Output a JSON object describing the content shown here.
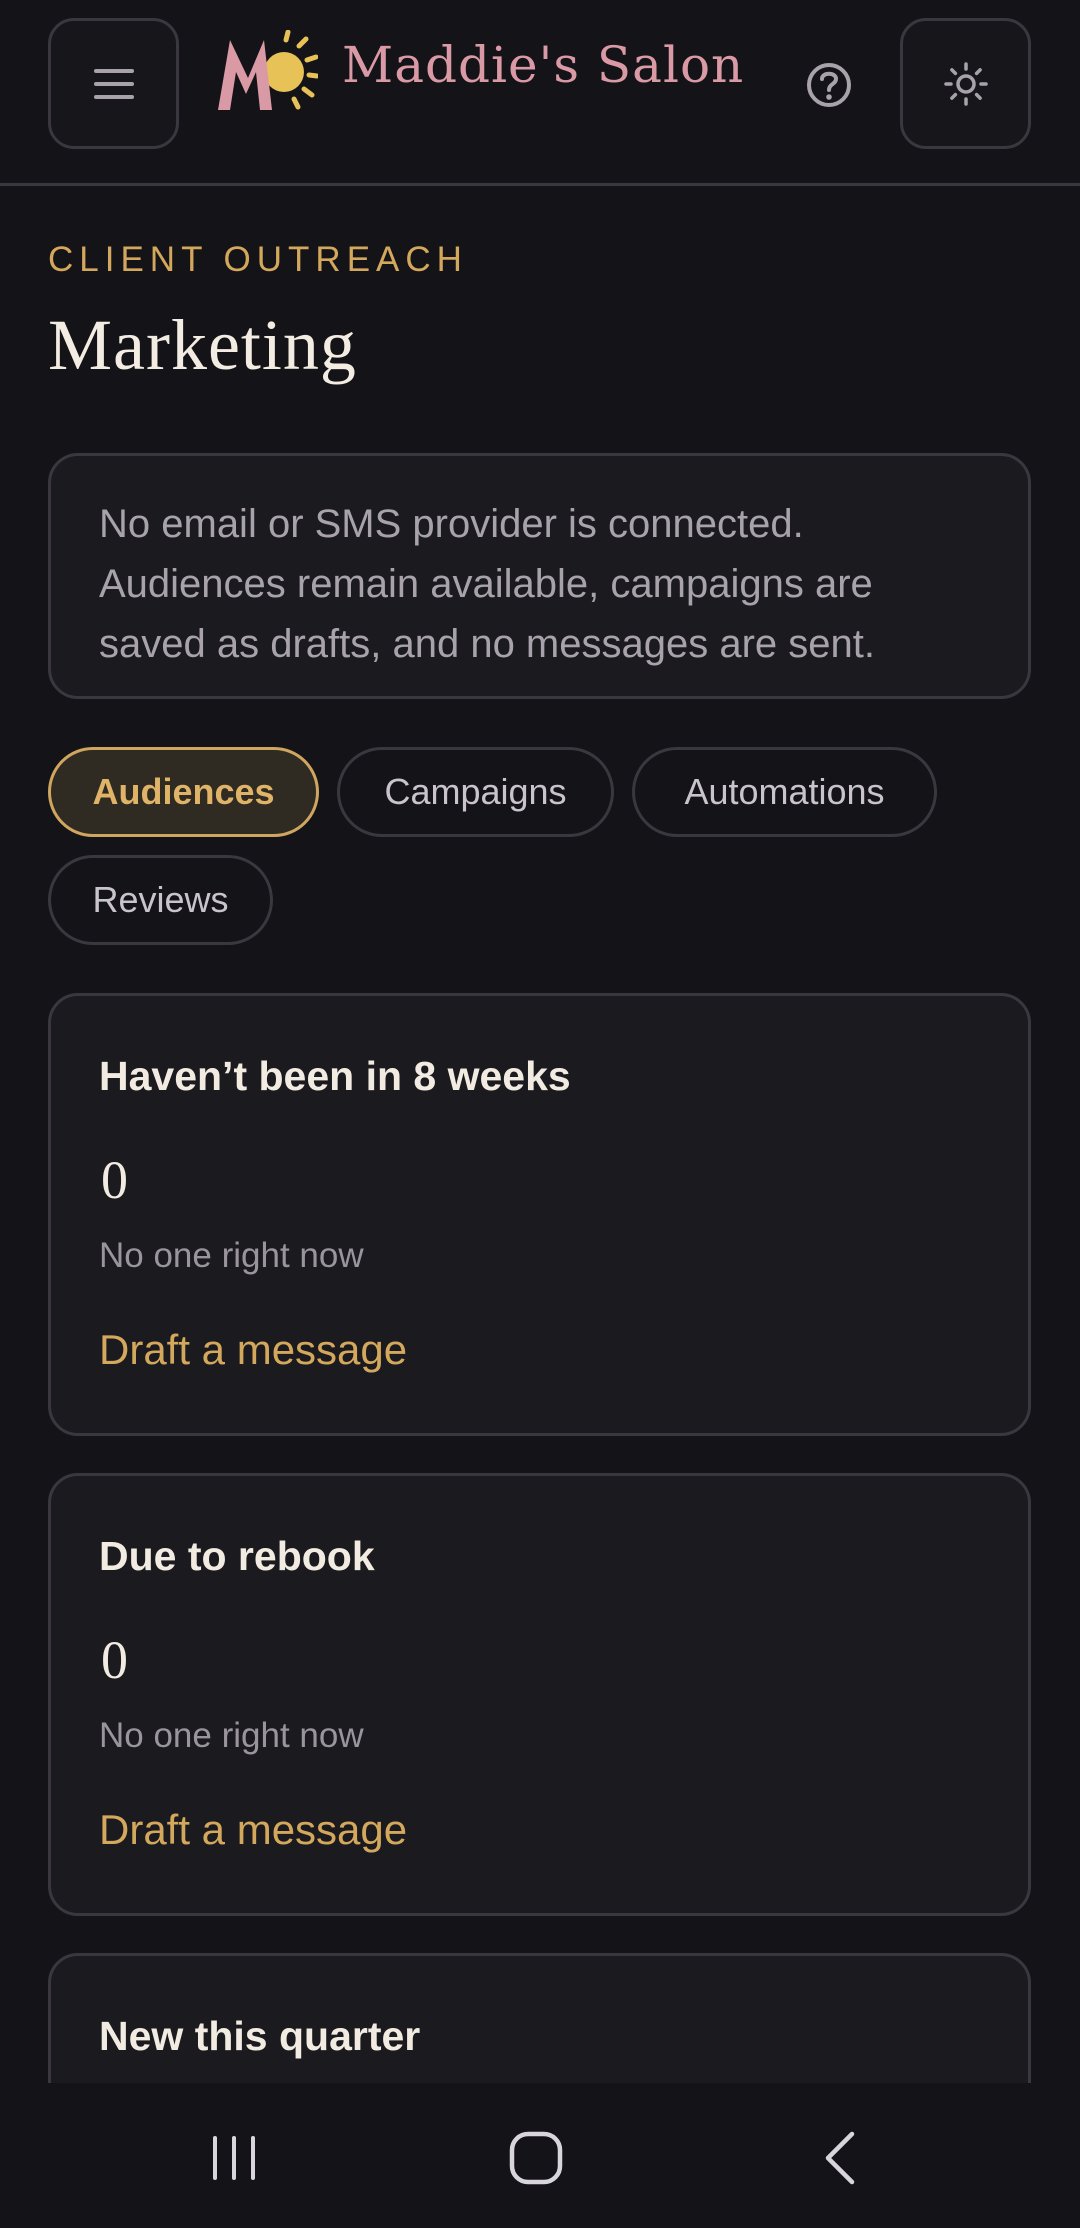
{
  "header": {
    "brand_name": "Maddie's Salon",
    "logo_letter": "M",
    "icons": {
      "menu": "hamburger-menu-icon",
      "help": "help-circle-icon",
      "theme": "sun-icon"
    }
  },
  "page": {
    "eyebrow": "CLIENT OUTREACH",
    "title": "Marketing"
  },
  "notice": {
    "line1": "No email or SMS provider is connected.",
    "line2": "Audiences remain available, campaigns are",
    "line3": "saved as drafts, and no messages are sent."
  },
  "tabs": [
    {
      "label": "Audiences",
      "active": true
    },
    {
      "label": "Campaigns",
      "active": false
    },
    {
      "label": "Automations",
      "active": false
    },
    {
      "label": "Reviews",
      "active": false
    }
  ],
  "audiences": [
    {
      "title": "Haven’t been in 8 weeks",
      "count": "0",
      "status": "No one right now",
      "action": "Draft a message"
    },
    {
      "title": "Due to rebook",
      "count": "0",
      "status": "No one right now",
      "action": "Draft a message"
    },
    {
      "title": "New this quarter"
    }
  ],
  "colors": {
    "background": "#141318",
    "card": "#1b1a1f",
    "border": "#3a373f",
    "accent_gold": "#d3a85c",
    "brand_pink": "#d99aa6"
  },
  "system_nav": {
    "recents": "recents-icon",
    "home": "home-icon",
    "back": "back-icon"
  }
}
